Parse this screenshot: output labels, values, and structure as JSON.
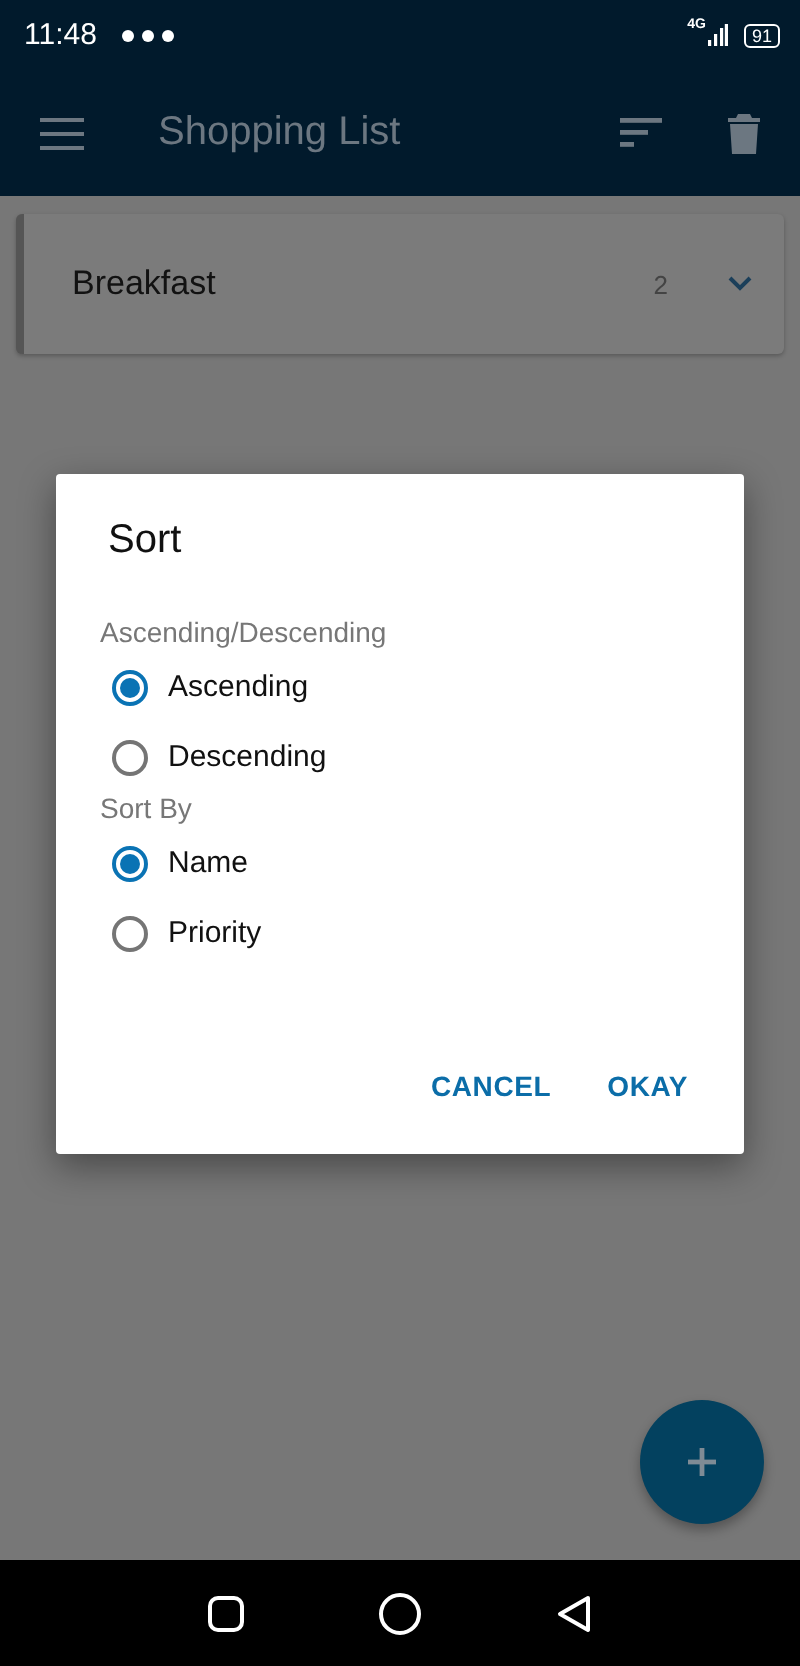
{
  "status_bar": {
    "time": "11:48",
    "network": "4G",
    "battery": "91"
  },
  "app_bar": {
    "title": "Shopping List"
  },
  "lists": [
    {
      "name": "Breakfast",
      "count": "2",
      "expanded": false
    }
  ],
  "dialog": {
    "title": "Sort",
    "groups": [
      {
        "label": "Ascending/Descending",
        "options": [
          {
            "label": "Ascending",
            "selected": true
          },
          {
            "label": "Descending",
            "selected": false
          }
        ]
      },
      {
        "label": "Sort By",
        "options": [
          {
            "label": "Name",
            "selected": true
          },
          {
            "label": "Priority",
            "selected": false
          }
        ]
      }
    ],
    "buttons": [
      "CANCEL",
      "OKAY"
    ]
  }
}
